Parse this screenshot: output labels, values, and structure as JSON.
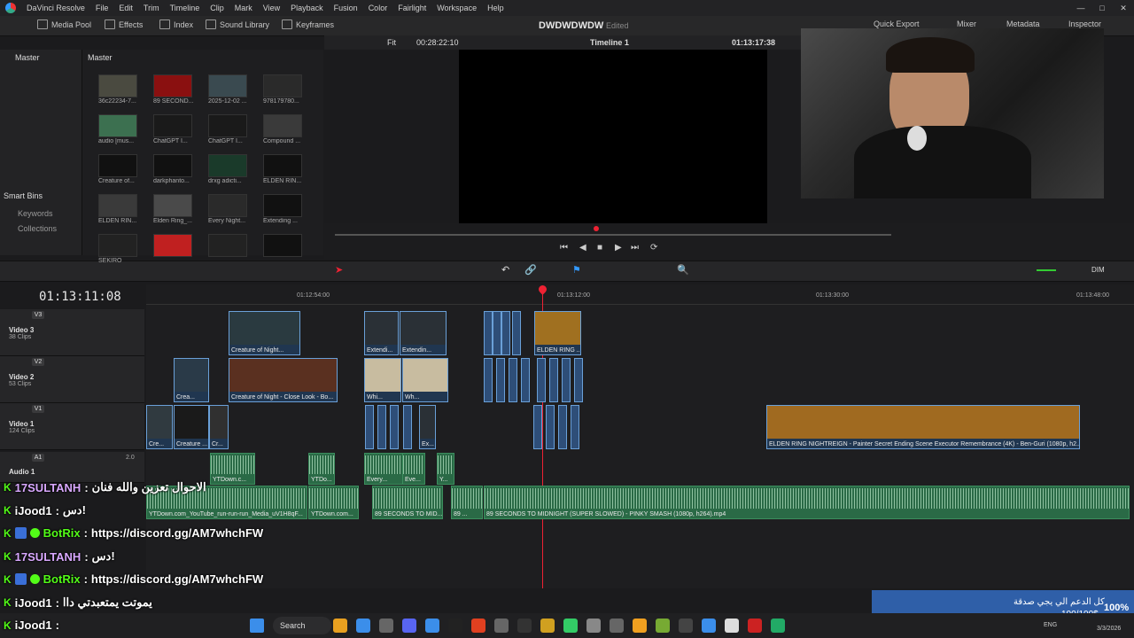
{
  "menubar": {
    "app_title": "DaVinci Resolve",
    "items": [
      "File",
      "Edit",
      "Trim",
      "Timeline",
      "Clip",
      "Mark",
      "View",
      "Playback",
      "Fusion",
      "Color",
      "Fairlight",
      "Workspace",
      "Help"
    ]
  },
  "toolbar": {
    "media_pool": "Media Pool",
    "effects": "Effects",
    "index": "Index",
    "sound_library": "Sound Library",
    "keyframes": "Keyframes",
    "quick_export": "Quick Export",
    "mixer": "Mixer",
    "metadata": "Metadata",
    "inspector": "Inspector"
  },
  "project": {
    "title": "DWDWDWDW",
    "status": "Edited"
  },
  "left_panel": {
    "master": "Master",
    "smart_bins": "Smart Bins",
    "keywords": "Keywords",
    "collections": "Collections"
  },
  "pool": {
    "title": "Master",
    "items": [
      {
        "label": "36c22234-7..."
      },
      {
        "label": "89 SECOND..."
      },
      {
        "label": "2025-12-02 ..."
      },
      {
        "label": "978179780..."
      },
      {
        "label": "audio [mus..."
      },
      {
        "label": "ChatGPT I..."
      },
      {
        "label": "ChatGPT I..."
      },
      {
        "label": "Compound ..."
      },
      {
        "label": "Creature of..."
      },
      {
        "label": "darkphanto..."
      },
      {
        "label": "drxg adicti..."
      },
      {
        "label": "ELDEN RIN..."
      },
      {
        "label": "ELDEN RIN..."
      },
      {
        "label": "Elden Ring_..."
      },
      {
        "label": "Every Night..."
      },
      {
        "label": "Extending ..."
      },
      {
        "label": "SEKIRO"
      },
      {
        "label": ""
      },
      {
        "label": ""
      },
      {
        "label": ""
      }
    ]
  },
  "viewer": {
    "fit": "Fit",
    "source_tc": "00:28:22:10",
    "timeline_name": "Timeline 1",
    "record_tc": "01:13:17:38"
  },
  "timeline": {
    "timecode": "01:13:11:08",
    "ruler": [
      "01:12:54:00",
      "01:13:12:00",
      "01:13:30:00",
      "01:13:48:00"
    ],
    "tracks": [
      {
        "id": "V3",
        "name": "Video 3",
        "clips": "38 Clips"
      },
      {
        "id": "V2",
        "name": "Video 2",
        "clips": "53 Clips"
      },
      {
        "id": "V1",
        "name": "Video 1",
        "clips": "124 Clips"
      },
      {
        "id": "A1",
        "name": "Audio 1",
        "level": "2.0"
      }
    ],
    "video_clips": [
      {
        "label": "Creature of Night..."
      },
      {
        "label": "Extendi..."
      },
      {
        "label": "Extendin..."
      },
      {
        "label": "ELDEN RING ..."
      },
      {
        "label": "Crea..."
      },
      {
        "label": "Creature of Night - Close Look - Bo..."
      },
      {
        "label": "Whi..."
      },
      {
        "label": "Wh..."
      },
      {
        "label": "Cre..."
      },
      {
        "label": "Creature ..."
      },
      {
        "label": "Cr..."
      },
      {
        "label": "Ex..."
      },
      {
        "label": "ELDEN RING NIGHTREIGN - Painter Secret Ending Scene  Executor Remembrance (4K) - Ben-Guri (1080p, h2..."
      }
    ],
    "audio_clips": [
      {
        "label": "YTDown.c..."
      },
      {
        "label": "YTDo..."
      },
      {
        "label": "Every..."
      },
      {
        "label": "Eve..."
      },
      {
        "label": "Y..."
      },
      {
        "label": "YTDown.com_YouTube_run-run-run_Media_uV1H8qF..."
      },
      {
        "label": "YTDown.com..."
      },
      {
        "label": "89 SECONDS TO MID..."
      },
      {
        "label": "89 ..."
      },
      {
        "label": "89 SECONDS TO MIDNIGHT (SUPER SLOWED) - PINKY SMASH (1080p, h264).mp4"
      }
    ],
    "dim": "DIM"
  },
  "chat": [
    {
      "user": "17SULTANH",
      "message": "الاحوال تعزين والله فنان",
      "user_color": "#d9a8ff"
    },
    {
      "user": "iJood1",
      "message": "دس!",
      "user_color": "#ffffff"
    },
    {
      "user": "BotRix",
      "message": "https://discord.gg/AM7whchFW",
      "user_color": "#53fc18"
    },
    {
      "user": "17SULTANH",
      "message": "دس!",
      "user_color": "#d9a8ff"
    },
    {
      "user": "BotRix",
      "message": "https://discord.gg/AM7whchFW",
      "user_color": "#53fc18"
    },
    {
      "user": "iJood1",
      "message": "يموتت يمتعبدتي داا",
      "user_color": "#ffffff"
    },
    {
      "user": "iJood1",
      "message": "",
      "user_color": "#ffffff"
    }
  ],
  "donation": {
    "line1": "كل الدعم الي يجي صدقة",
    "line2": "100/100$",
    "percent": "100%"
  },
  "taskbar": {
    "search": "Search",
    "lang": "ENG",
    "date": "3/3/2026"
  },
  "colors": {
    "accent_red": "#e23030",
    "clip_blue": "#6aa0d8",
    "audio_green": "#2a6a46",
    "kick_green": "#53fc18"
  }
}
